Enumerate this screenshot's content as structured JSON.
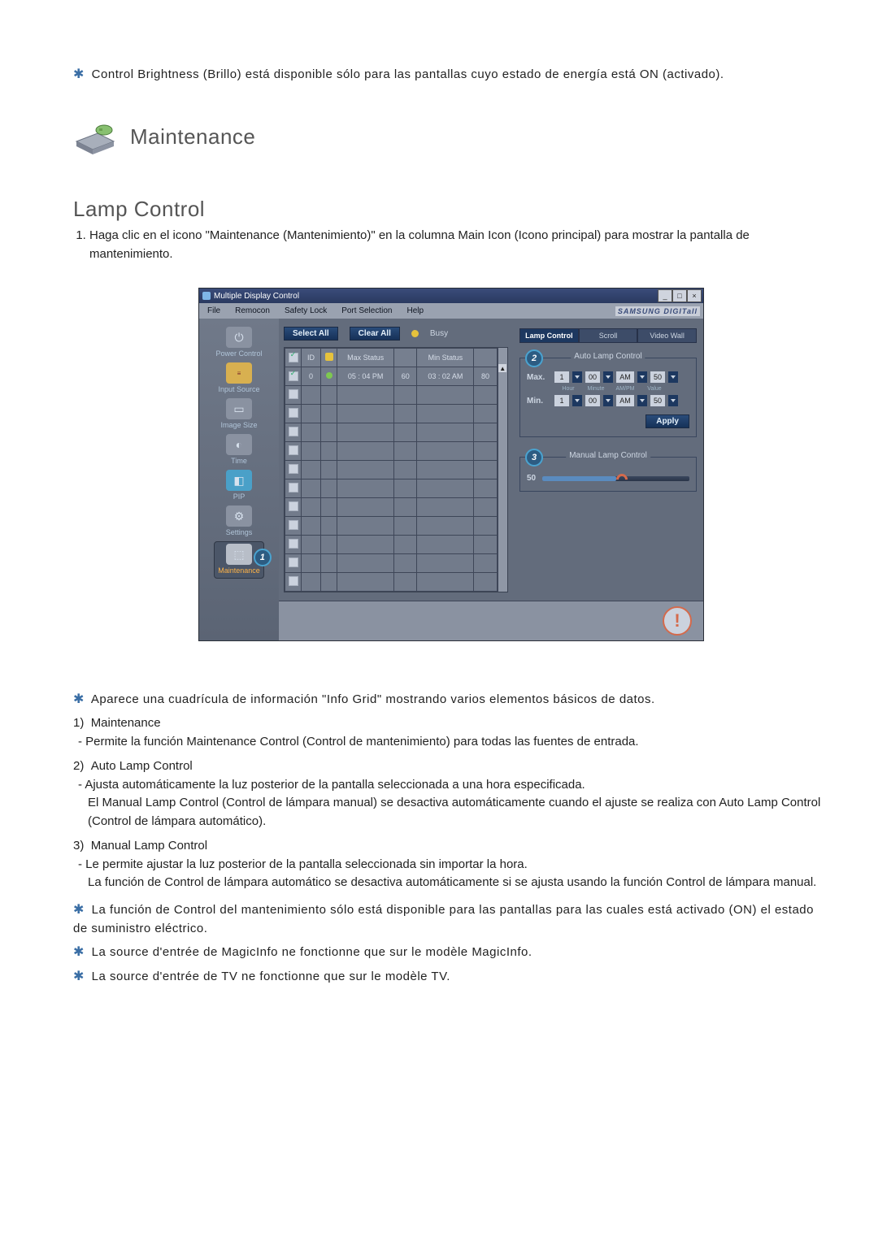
{
  "intro_note": "Control Brightness (Brillo) está disponible sólo para las pantallas cuyo estado de energía está ON (activado).",
  "maintenance_heading": "Maintenance",
  "lamp_control_heading": "Lamp Control",
  "instruction_1": "Haga clic en el icono \"Maintenance (Mantenimiento)\" en la columna Main Icon (Icono principal) para mostrar la pantalla de mantenimiento.",
  "app": {
    "title": "Multiple Display Control",
    "menu": [
      "File",
      "Remocon",
      "Safety Lock",
      "Port Selection",
      "Help"
    ],
    "brand": "SAMSUNG DIGITall",
    "sidebar": {
      "items": [
        {
          "label": "Power Control"
        },
        {
          "label": "Input Source"
        },
        {
          "label": "Image Size"
        },
        {
          "label": "Time"
        },
        {
          "label": "PIP"
        },
        {
          "label": "Settings"
        },
        {
          "label": "Maintenance",
          "selected": true,
          "badge": "1"
        }
      ]
    },
    "toolbar": {
      "select_all": "Select All",
      "clear_all": "Clear All",
      "busy_label": "Busy"
    },
    "grid": {
      "headers": {
        "check": "✓",
        "id": "ID",
        "status_icon": " ",
        "max_status": "Max Status",
        "max_val": " ",
        "min_status": "Min Status",
        "min_val": " "
      },
      "row": {
        "id": "0",
        "max_status": "05 : 04 PM",
        "max_val": "60",
        "min_status": "03 : 02 AM",
        "min_val": "80"
      },
      "empty_rows": 11
    },
    "tabs": {
      "lamp_control": "Lamp Control",
      "scroll": "Scroll",
      "video_wall": "Video Wall"
    },
    "auto_lamp": {
      "title": "Auto Lamp Control",
      "badge": "2",
      "rows": [
        {
          "label": "Max.",
          "hour": "1",
          "minute": "00",
          "ampm": "AM",
          "value": "50"
        },
        {
          "label": "Min.",
          "hour": "1",
          "minute": "00",
          "ampm": "AM",
          "value": "50"
        }
      ],
      "sub_labels": [
        "Hour",
        "Minute",
        "AM/PM",
        "Value"
      ],
      "apply": "Apply"
    },
    "manual_lamp": {
      "title": "Manual Lamp Control",
      "badge": "3",
      "value": "50"
    }
  },
  "after_screenshot": {
    "bullet1": "Aparece una cuadrícula de información \"Info Grid\" mostrando varios elementos básicos de datos.",
    "n1_title": "Maintenance",
    "n1_dash": "Permite la función Maintenance Control (Control de mantenimiento) para todas las fuentes de entrada.",
    "n2_title": "Auto Lamp Control",
    "n2_dash": "Ajusta automáticamente la luz posterior de la pantalla seleccionada a una hora especificada.",
    "n2_body": "El Manual Lamp Control (Control de lámpara manual) se desactiva automáticamente cuando el ajuste se realiza con Auto Lamp Control (Control de lámpara automático).",
    "n3_title": "Manual Lamp Control",
    "n3_dash": "Le permite ajustar la luz posterior de la pantalla seleccionada sin importar la hora.",
    "n3_body": "La función de Control de lámpara automático se desactiva automáticamente si se ajusta usando la función Control de lámpara manual.",
    "bullet2": "La función de Control del mantenimiento sólo está disponible para las pantallas para las cuales está activado (ON) el estado de suministro eléctrico.",
    "bullet3": "La source d'entrée de MagicInfo ne fonctionne que sur le modèle MagicInfo.",
    "bullet4": "La source d'entrée de TV ne fonctionne que sur le modèle TV."
  }
}
